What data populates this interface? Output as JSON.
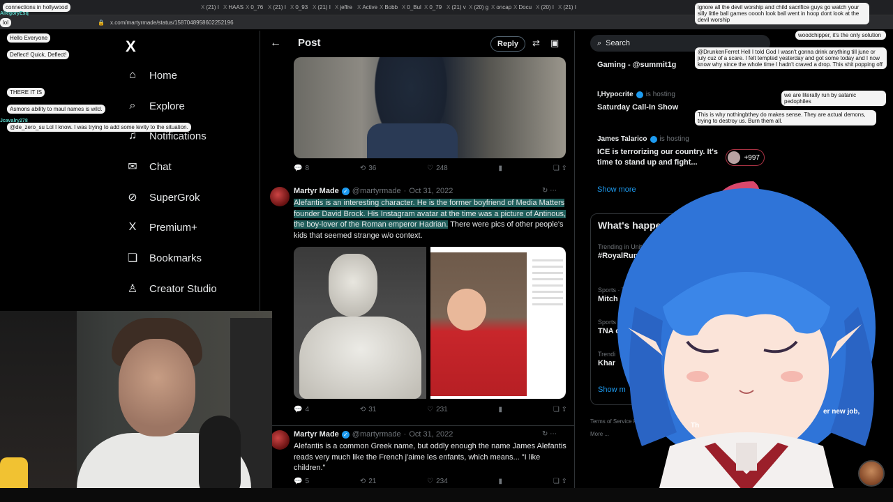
{
  "browser": {
    "tabs": [
      "(21) I",
      "HAAS",
      "0_76",
      "(21) I",
      "0_93",
      "(21) I",
      "jeffre",
      "Active",
      "Bobb",
      "0_Bul",
      "0_79",
      "(21) v",
      "(20) g",
      "oncap",
      "Docu",
      "(20) I",
      "(21) I"
    ],
    "url": "x.com/martyrmade/status/1587048958602252196"
  },
  "nav": {
    "logo": "X",
    "items": [
      {
        "icon": "home-icon",
        "glyph": "⌂",
        "label": "Home"
      },
      {
        "icon": "search-icon",
        "glyph": "⌕",
        "label": "Explore"
      },
      {
        "icon": "bell-icon",
        "glyph": "♫",
        "label": "Notifications"
      },
      {
        "icon": "mail-icon",
        "glyph": "✉",
        "label": "Chat"
      },
      {
        "icon": "grok-icon",
        "glyph": "⊘",
        "label": "SuperGrok"
      },
      {
        "icon": "x-icon",
        "glyph": "X",
        "label": "Premium+"
      },
      {
        "icon": "bookmark-icon",
        "glyph": "❏",
        "label": "Bookmarks"
      },
      {
        "icon": "creator-icon",
        "glyph": "♙",
        "label": "Creator Studio"
      }
    ]
  },
  "header": {
    "title": "Post",
    "reply": "Reply"
  },
  "tweet0": {
    "replies": "8",
    "retweets": "36",
    "likes": "248"
  },
  "tweet1": {
    "name": "Martyr Made",
    "handle": "@martyrmade",
    "date": "Oct 31, 2022",
    "text_highlight": "Alefantis is an interesting character. He is the former boyfriend of Media Matters founder David Brock. His Instagram avatar at the time was a picture of Antinous, the boy-lover of the Roman emperor Hadrian.",
    "text_rest": " There were pics of other people's kids that seemed strange w/o context.",
    "replies": "4",
    "retweets": "31",
    "likes": "231"
  },
  "tweet2": {
    "name": "Martyr Made",
    "handle": "@martyrmade",
    "date": "Oct 31, 2022",
    "text": "Alefantis is a common Greek name, but oddly enough the name James Alefantis reads very much like the French j'aime les enfants, which means... \"I like children.\"",
    "replies": "5",
    "retweets": "21",
    "likes": "234"
  },
  "sidebar": {
    "search": "Search",
    "live": [
      {
        "who": "Gaming - @summit1g",
        "host": "",
        "title": ""
      },
      {
        "who": "I,Hypocrite",
        "host": "is hosting",
        "title": "Saturday Call-In Show"
      },
      {
        "who": "James Talarico",
        "host": "is hosting",
        "title": "ICE is terrorizing our country. It's time to stand up and fight..."
      }
    ],
    "listeners": "+997",
    "show_more": "Show more",
    "whats_happening": "What's happening",
    "trends": [
      {
        "meta": "Trending in United St",
        "name": "#RoyalRumble"
      },
      {
        "meta": "Sports · Trend",
        "name": "Mitch Johns"
      },
      {
        "meta": "Sports · Tre",
        "name": "TNA or A"
      },
      {
        "meta": "Trendi",
        "name": "Khar"
      }
    ],
    "show_more2": "Show m",
    "footer": "Terms of Service   Privacy Policy   Cookie Policy   Accessibility   Ads info   More ..."
  },
  "chat_left": [
    {
      "user": "",
      "text": "connections in hollywood"
    },
    {
      "user": "AllegoryEsq",
      "text": "lol"
    },
    {
      "user": "",
      "text": "Hello Everyone"
    },
    {
      "user": "",
      "text": "Deflect! Quick, Deflect!"
    },
    {
      "user": "",
      "text": "THERE IT IS"
    },
    {
      "user": "",
      "text": "Asmons ability to maul names is wild."
    },
    {
      "user": "Jcavalry278",
      "text": "@de_zero_su Lol I know. I was trying to add some levity to the situation."
    }
  ],
  "chat_right": [
    {
      "text": "ignore all the devil worship and child sacrifice guys go watch your silly little ball games ooooh look ball went in hoop dont look at the devil worship"
    },
    {
      "text": "woodchipper, it's the only solution"
    },
    {
      "text": "@DrunkenFerret Hell I told God I wasn't gonna drink anything till june or july cuz of a scare. I felt tempted yesterday and got some today and I now know why since the whole time I hadn't craved a drop. This shit popping off"
    },
    {
      "text": "we are literally run by satanic pedophiles"
    },
    {
      "text": "This is why nothingbthey do makes sense. They are actual demons, trying to destroy us. Burn them all."
    }
  ],
  "overlay_partial": {
    "a": "Th",
    "b": "er new job,"
  }
}
